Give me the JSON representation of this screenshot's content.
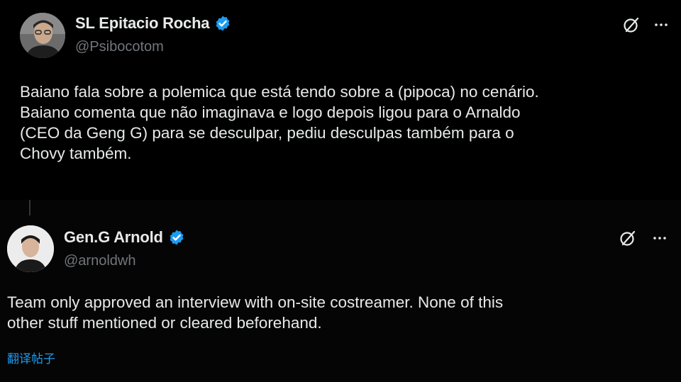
{
  "tweets": [
    {
      "author_name": "SL Epitacio Rocha",
      "handle": "@Psibocotom",
      "verified": true,
      "text": "Baiano fala sobre a polemica que está tendo sobre a (pipoca) no cenário.\nBaiano comenta que não imaginava e logo depois ligou para o Arnaldo\n(CEO da Geng G) para se desculpar, pediu desculpas também para o\nChovy também."
    },
    {
      "author_name": "Gen.G Arnold",
      "handle": "@arnoldwh",
      "verified": true,
      "text": "Team only approved an interview with on-site costreamer. None of this\nother stuff mentioned or cleared beforehand.",
      "translate_label": "翻译帖子"
    }
  ],
  "icons": {
    "verified": "verified-badge-icon",
    "grok": "grok-icon",
    "more": "more-options-icon"
  },
  "colors": {
    "background": "#000000",
    "text": "#e7e9ea",
    "secondary_text": "#71767b",
    "accent": "#1d9bf0"
  }
}
